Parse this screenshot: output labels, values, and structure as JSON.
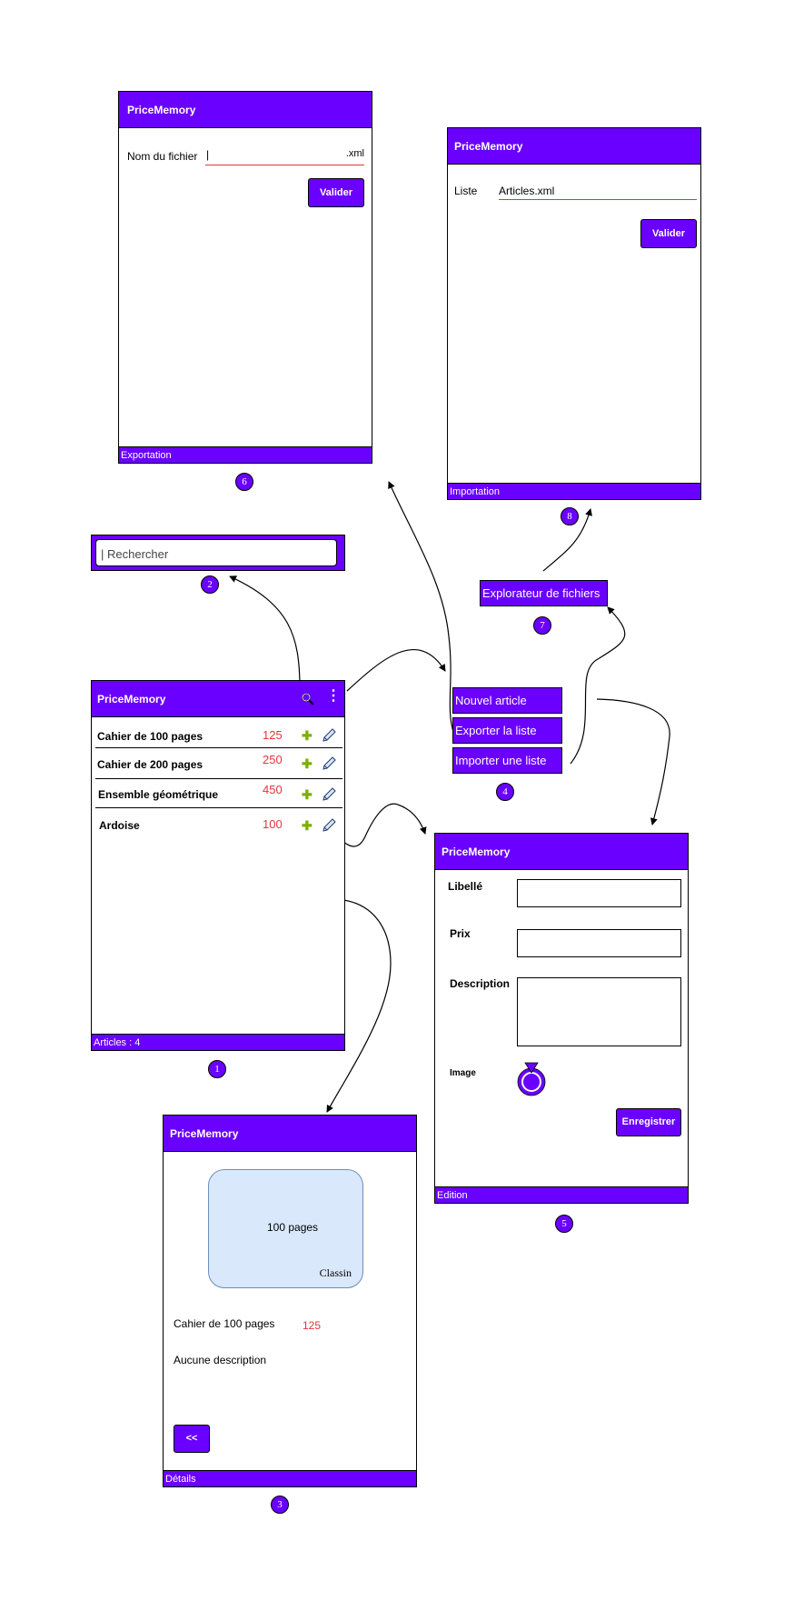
{
  "app_name": "PriceMemory",
  "colors": {
    "accent": "#6a00ff",
    "price": "#e8333a",
    "plus": "#7ab000",
    "image_frame": "#dae8fc"
  },
  "badges": [
    "1",
    "2",
    "3",
    "4",
    "5",
    "6",
    "7",
    "8"
  ],
  "screen1": {
    "footer": "Articles : 4",
    "icons": [
      "search-icon",
      "more-vertical-icon",
      "plus-icon",
      "pencil-icon"
    ],
    "items": [
      {
        "label": "Cahier de 100 pages",
        "price": "125"
      },
      {
        "label": "Cahier de 200 pages",
        "price": "250"
      },
      {
        "label": "Ensemble géométrique",
        "price": "450"
      },
      {
        "label": "Ardoise",
        "price": "100"
      }
    ]
  },
  "screen2": {
    "search_placeholder": "| Rechercher"
  },
  "screen3": {
    "image_title": "100 pages",
    "image_brand": "Classin",
    "article_label": "Cahier de 100 pages",
    "article_price": "125",
    "description": "Aucune description",
    "back_button": "<<",
    "footer": "Détails"
  },
  "screen4": {
    "menu": [
      "Nouvel article",
      "Exporter la liste",
      "Importer une liste"
    ]
  },
  "screen5": {
    "label_libelle": "Libellé",
    "label_prix": "Prix",
    "label_description": "Description",
    "label_image": "Image",
    "save_button": "Enregistrer",
    "footer": "Edition"
  },
  "screen6": {
    "file_label": "Nom du fichier",
    "file_value": "|",
    "file_extension": ".xml",
    "validate_button": "Valider",
    "footer": "Exportation"
  },
  "screen7": {
    "file_explorer": "Explorateur de fichiers"
  },
  "screen8": {
    "list_label": "Liste",
    "list_value": "Articles.xml",
    "validate_button": "Valider",
    "footer": "Importation"
  }
}
